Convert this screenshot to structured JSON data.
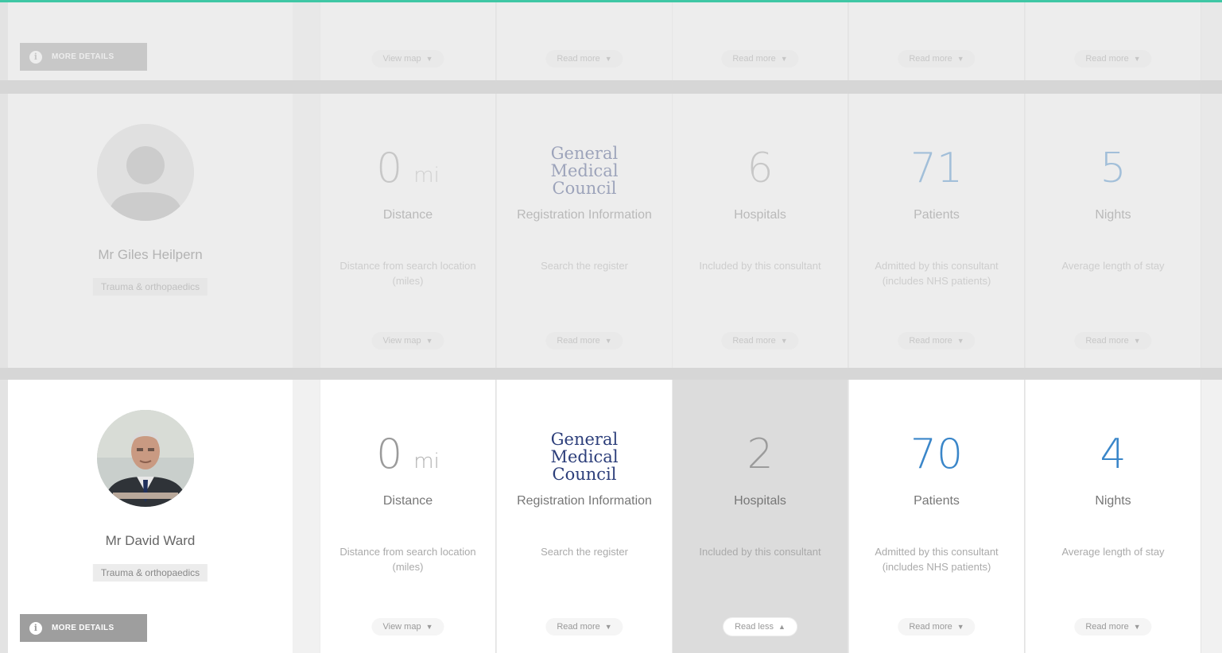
{
  "top_row": {
    "more_details_label": "MORE DETAILS",
    "pills": [
      "View map",
      "Read more",
      "Read more",
      "Read more",
      "Read more"
    ]
  },
  "consultants": [
    {
      "name": "Mr Giles Heilpern",
      "specialty": "Trauma & orthopaedics",
      "distance": {
        "value": "0",
        "unit": "mi",
        "label": "Distance",
        "desc": "Distance from search location (miles)",
        "link": "View map"
      },
      "registration": {
        "logo_line1": "General",
        "logo_line2": "Medical",
        "logo_line3": "Council",
        "label": "Registration Information",
        "desc": "Search the register",
        "link": "Read more"
      },
      "hospitals": {
        "value": "6",
        "label": "Hospitals",
        "desc": "Included by this consultant",
        "link": "Read more"
      },
      "patients": {
        "value": "71",
        "label": "Patients",
        "desc": "Admitted by this consultant (includes NHS patients)",
        "link": "Read more"
      },
      "nights": {
        "value": "5",
        "label": "Nights",
        "desc": "Average length of stay",
        "link": "Read more"
      }
    },
    {
      "name": "Mr David Ward",
      "specialty": "Trauma & orthopaedics",
      "more_details_label": "MORE DETAILS",
      "distance": {
        "value": "0",
        "unit": "mi",
        "label": "Distance",
        "desc": "Distance from search location (miles)",
        "link": "View map"
      },
      "registration": {
        "logo_line1": "General",
        "logo_line2": "Medical",
        "logo_line3": "Council",
        "label": "Registration Information",
        "desc": "Search the register",
        "link": "Read more"
      },
      "hospitals": {
        "value": "2",
        "label": "Hospitals",
        "desc": "Included by this consultant",
        "link": "Read less"
      },
      "patients": {
        "value": "70",
        "label": "Patients",
        "desc": "Admitted by this consultant (includes NHS patients)",
        "link": "Read more"
      },
      "nights": {
        "value": "4",
        "label": "Nights",
        "desc": "Average length of stay",
        "link": "Read more"
      }
    }
  ],
  "colors": {
    "accent_line": "#3fc7a5",
    "stat_blue": "#3a86c9",
    "gmc_navy": "#2c3e7a"
  }
}
